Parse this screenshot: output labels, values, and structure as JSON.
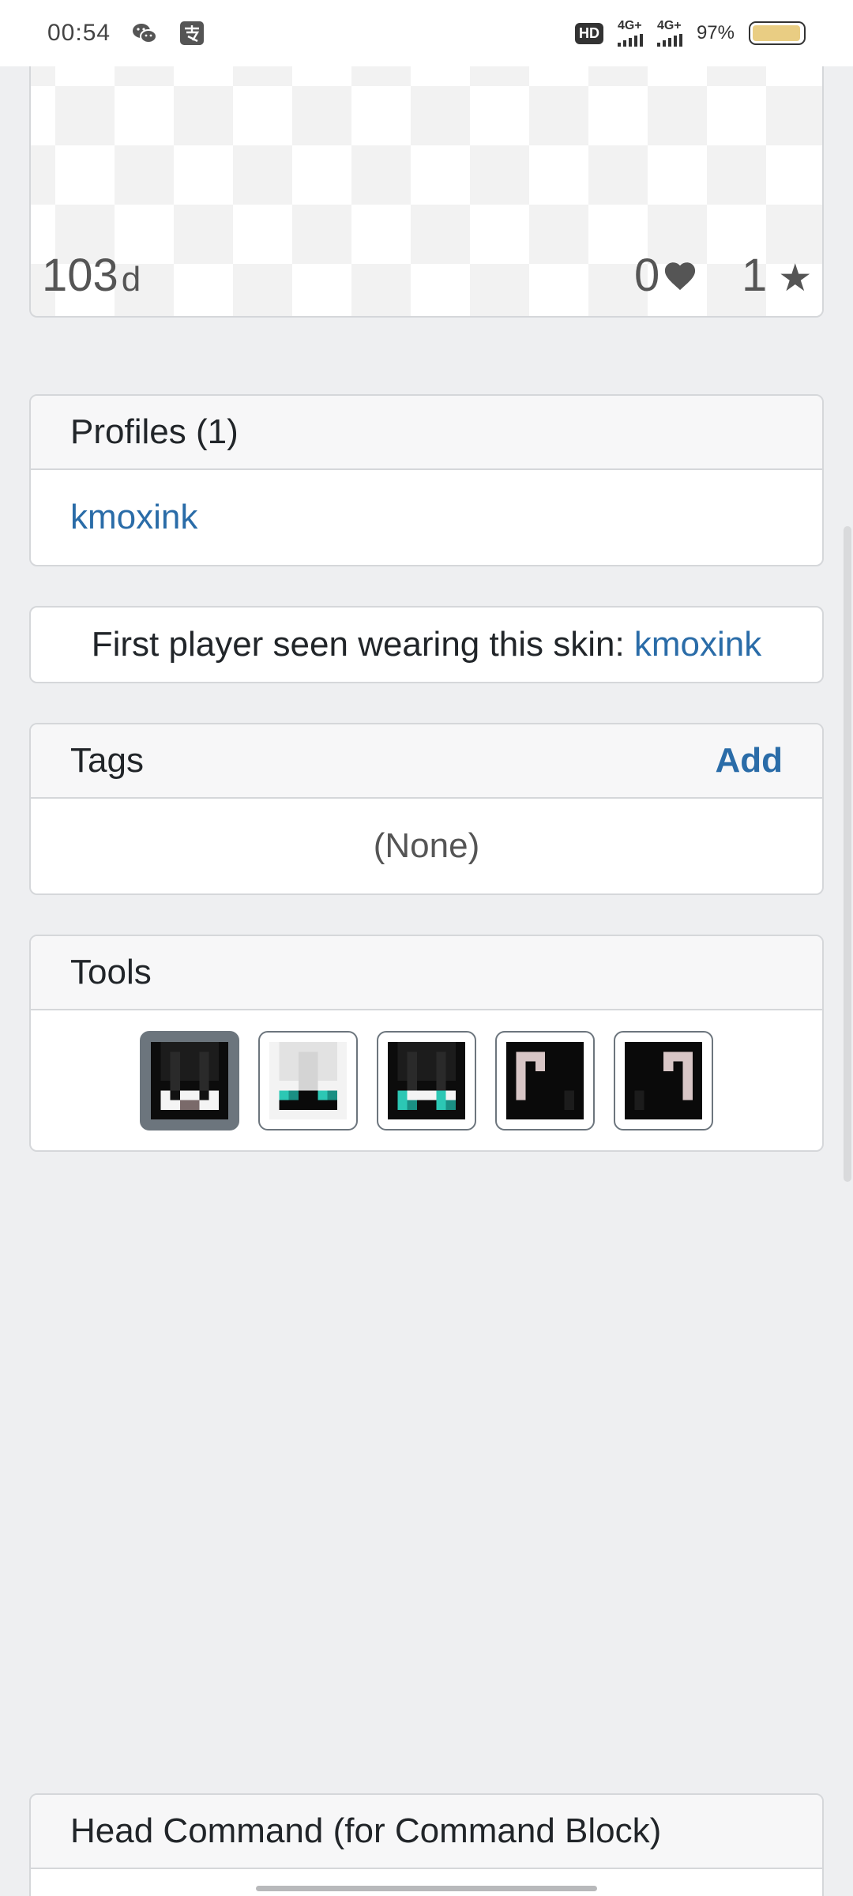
{
  "status_bar": {
    "time": "00:54",
    "net1": "4G+",
    "net2": "4G+",
    "battery_percent": "97%",
    "hd_label": "HD",
    "icons": [
      "wechat-icon",
      "alipay-icon",
      "hd-icon",
      "signal-icon",
      "battery-icon"
    ],
    "battery_color": "#e9cd83"
  },
  "preview": {
    "days": "103",
    "days_unit": "d",
    "likes": "0",
    "stars": "1",
    "like_icon": "heart-icon",
    "star_icon": "star-icon"
  },
  "profiles": {
    "title": "Profiles (1)",
    "items": [
      "kmoxink"
    ]
  },
  "first_seen": {
    "label": "First player seen wearing this skin: ",
    "player": "kmoxink"
  },
  "tags": {
    "title": "Tags",
    "add_label": "Add",
    "empty_text": "(None)"
  },
  "tools": {
    "title": "Tools",
    "items": [
      {
        "name": "head-front",
        "active": true
      },
      {
        "name": "head-front-variant",
        "active": false
      },
      {
        "name": "head-front-overlay",
        "active": false
      },
      {
        "name": "head-side-left",
        "active": false
      },
      {
        "name": "head-side-right",
        "active": false
      }
    ]
  },
  "head_command": {
    "title": "Head Command (for Command Block)"
  },
  "colors": {
    "link": "#2a6ca8",
    "page_bg": "#eeeff1",
    "active_tool": "#6c757d"
  }
}
